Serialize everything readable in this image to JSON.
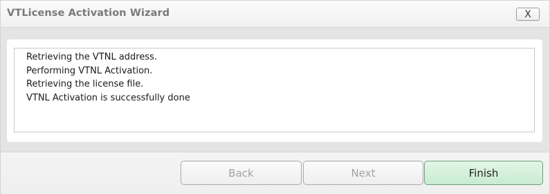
{
  "window": {
    "title": "VTLicense Activation Wizard",
    "close_label": "X"
  },
  "log": {
    "lines": [
      "Retrieving the VTNL address.",
      "Performing VTNL Activation.",
      "Retrieving the license file.",
      "VTNL Activation is successfully done"
    ]
  },
  "buttons": {
    "back": "Back",
    "next": "Next",
    "finish": "Finish"
  },
  "colors": {
    "finish_accent": "#c8ebd1",
    "disabled_text": "#a3a3a3"
  }
}
